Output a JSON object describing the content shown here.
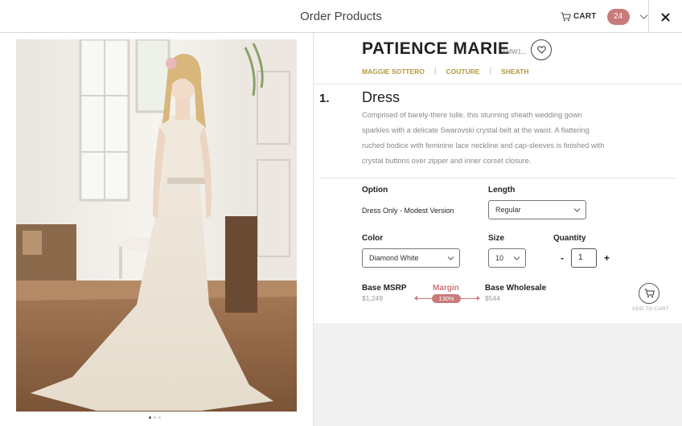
{
  "header": {
    "title": "Order Products",
    "cart_label": "CART",
    "cart_count": "24"
  },
  "carousel": {
    "image_alt": "Bride in a sheath wedding gown",
    "dots_total": 3,
    "dots_active": 1
  },
  "product": {
    "name": "PATIENCE MARIE",
    "code": "5MW1...",
    "tags": [
      "MAGGIE SOTTERO",
      "COUTURE",
      "SHEATH"
    ]
  },
  "item": {
    "number": "1.",
    "title": "Dress",
    "description": "Comprised of barely-there tulle, this stunning sheath wedding gown sparkles with a delicate Swarovski crystal belt at the waist. A flattering ruched bodice with feminine lace neckline and cap-sleeves is finished with crystal buttons over zipper and inner corset closure."
  },
  "options": {
    "option_label": "Option",
    "option_value": "Dress Only - Modest Version",
    "length_label": "Length",
    "length_value": "Regular",
    "color_label": "Color",
    "color_value": "Diamond White",
    "size_label": "Size",
    "size_value": "10",
    "quantity_label": "Quantity",
    "quantity_value": "1",
    "minus": "-",
    "plus": "+"
  },
  "pricing": {
    "msrp_label": "Base MSRP",
    "msrp_value": "$1,249",
    "margin_label": "Margin",
    "margin_value": "130%",
    "wholesale_label": "Base Wholesale",
    "wholesale_value": "$544",
    "add_to_cart": "ADD TO CART"
  },
  "colors": {
    "accent": "#c97a7a",
    "tag_gold": "#b19a3b"
  }
}
